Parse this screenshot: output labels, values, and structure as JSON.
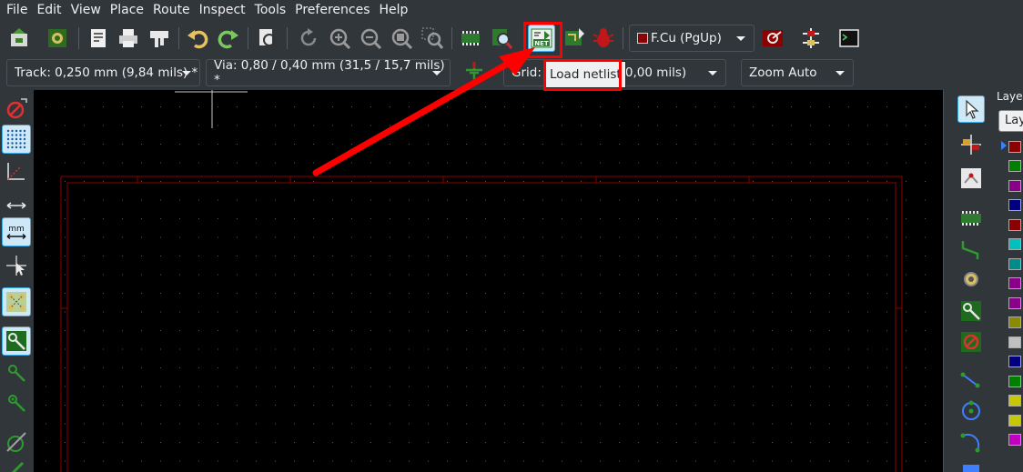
{
  "menubar": {
    "items": [
      "File",
      "Edit",
      "View",
      "Place",
      "Route",
      "Inspect",
      "Tools",
      "Preferences",
      "Help"
    ]
  },
  "toolbar": {
    "buttons": [
      {
        "name": "board-setup-icon"
      },
      {
        "name": "footprint-editor-icon"
      },
      {
        "name": "page-settings-icon"
      },
      {
        "name": "print-icon"
      },
      {
        "name": "plot-icon"
      },
      {
        "name": "undo-icon"
      },
      {
        "name": "redo-icon"
      },
      {
        "name": "find-icon"
      },
      {
        "name": "refresh-icon"
      },
      {
        "name": "zoom-in-icon"
      },
      {
        "name": "zoom-out-icon"
      },
      {
        "name": "zoom-fit-icon"
      },
      {
        "name": "zoom-selection-icon"
      },
      {
        "name": "footprint-library-icon"
      },
      {
        "name": "footprint-browser-icon"
      },
      {
        "name": "load-netlist-icon"
      },
      {
        "name": "update-from-schematic-icon"
      },
      {
        "name": "drc-icon"
      },
      {
        "name": "layer-pair-icon"
      },
      {
        "name": "microwave-icon"
      },
      {
        "name": "scripting-console-icon"
      }
    ],
    "layer_select": "F.Cu (PgUp)",
    "layer_color": "#8b0000"
  },
  "toolbar2": {
    "track_select": "Track: 0,250 mm (9,84 mils) *",
    "via_select": "Via: 0,80 / 0,40 mm (31,5 / 15,7 mils) *",
    "grid_prefix": "Grid:",
    "grid_suffix": "0,00 mils)",
    "zoom_select": "Zoom Auto"
  },
  "tooltip": {
    "text": "Load netlist"
  },
  "layers_panel": {
    "title": "Layers",
    "tab": "Layers",
    "swatches": [
      "#8b0000",
      "#008000",
      "#8b008b",
      "#000080",
      "#8b0000",
      "#00c0c0",
      "#008b8b",
      "#8b008b",
      "#8b008b",
      "#8b8b00",
      "#c0c0c0",
      "#000080",
      "#008000",
      "#c8c800",
      "#c8c800",
      "#c000c0"
    ]
  },
  "colors": {
    "background": "#31363b",
    "canvas": "#000000",
    "board_outline": "#8b0000",
    "highlight": "#ff0000",
    "accent": "#3daee9"
  }
}
